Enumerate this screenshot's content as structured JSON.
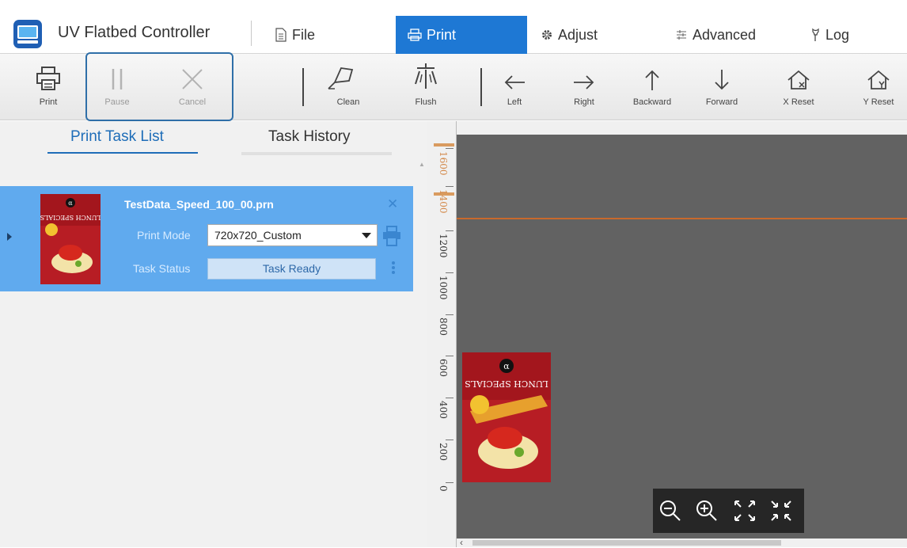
{
  "app": {
    "title": "UV Flatbed Controller",
    "logo_icon": "monitor-app-icon"
  },
  "menu": {
    "items": [
      {
        "label": "File",
        "icon": "document-icon"
      },
      {
        "label": "Print",
        "icon": "printer-icon",
        "active": true
      },
      {
        "label": "Adjust",
        "icon": "gear-icon"
      },
      {
        "label": "Advanced",
        "icon": "advanced-icon"
      },
      {
        "label": "Log",
        "icon": "pin-icon"
      }
    ]
  },
  "toolbar": {
    "print": "Print",
    "pause": "Pause",
    "cancel": "Cancel",
    "clean": "Clean",
    "flush": "Flush",
    "left": "Left",
    "right": "Right",
    "backward": "Backward",
    "forward": "Forward",
    "x_reset": "X Reset",
    "y_reset": "Y Reset"
  },
  "tabs": {
    "task_list": "Print Task List",
    "task_history": "Task History"
  },
  "task": {
    "name": "TestData_Speed_100_00.prn",
    "print_mode_label": "Print Mode",
    "print_mode_value": "720x720_Custom",
    "status_label": "Task Status",
    "status_value": "Task Ready",
    "thumbnail_text": "LUNCH SPECIALS",
    "thumbnail_badge": "α"
  },
  "ruler": {
    "labels": [
      "1600",
      "1400",
      "1200",
      "1000",
      "800",
      "600",
      "400",
      "200",
      "0"
    ]
  },
  "zoom": {
    "buttons": [
      "zoom-out-icon",
      "zoom-in-icon",
      "fit-screen-icon",
      "actual-size-icon"
    ]
  },
  "colors": {
    "accent": "#1e78d4",
    "selection": "#60aaee",
    "canvas": "#626262",
    "guide": "#c8692c"
  }
}
